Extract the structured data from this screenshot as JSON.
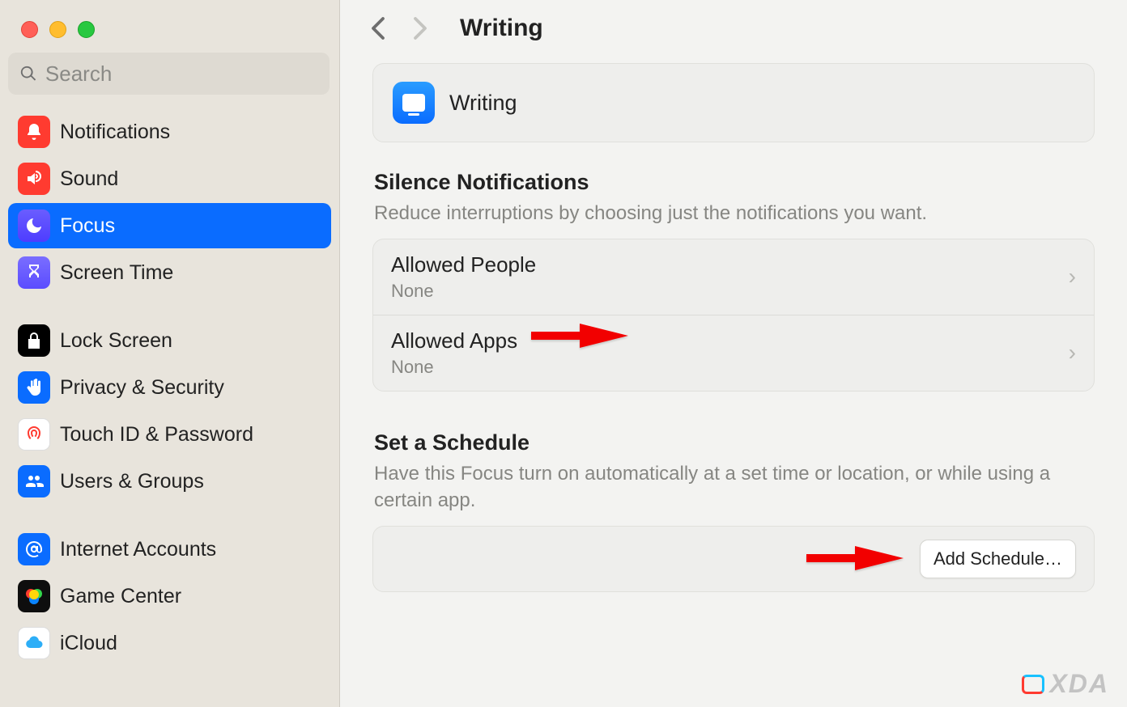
{
  "search": {
    "placeholder": "Search"
  },
  "sidebar": {
    "items": [
      {
        "label": "Notifications"
      },
      {
        "label": "Sound"
      },
      {
        "label": "Focus"
      },
      {
        "label": "Screen Time"
      },
      {
        "label": "Lock Screen"
      },
      {
        "label": "Privacy & Security"
      },
      {
        "label": "Touch ID & Password"
      },
      {
        "label": "Users & Groups"
      },
      {
        "label": "Internet Accounts"
      },
      {
        "label": "Game Center"
      },
      {
        "label": "iCloud"
      }
    ]
  },
  "header": {
    "title": "Writing"
  },
  "focus": {
    "name": "Writing"
  },
  "sections": {
    "silence": {
      "title": "Silence Notifications",
      "sub": "Reduce interruptions by choosing just the notifications you want."
    },
    "schedule": {
      "title": "Set a Schedule",
      "sub": "Have this Focus turn on automatically at a set time or location, or while using a certain app."
    }
  },
  "rows": {
    "people": {
      "title": "Allowed People",
      "sub": "None"
    },
    "apps": {
      "title": "Allowed Apps",
      "sub": "None"
    }
  },
  "buttons": {
    "addSchedule": "Add Schedule…"
  },
  "watermark": "XDA"
}
